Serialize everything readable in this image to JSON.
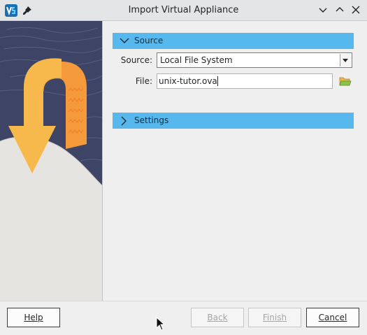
{
  "window": {
    "title": "Import Virtual Appliance"
  },
  "source_section": {
    "label": "Source",
    "source_label": "Source:",
    "source_value": "Local File System",
    "file_label": "File:",
    "file_value": "unix-tutor.ova"
  },
  "settings_section": {
    "label": "Settings"
  },
  "buttons": {
    "help": "Help",
    "back": "Back",
    "finish": "Finish",
    "cancel": "Cancel"
  },
  "colors": {
    "section_header": "#56b8ec",
    "side_dark": "#3d4466",
    "arrow_yellow": "#f7b94c",
    "arrow_orange": "#f59a3a"
  },
  "icons": {
    "app": "virtualbox-icon",
    "pin": "pin-icon",
    "minimize": "chevron-down-icon",
    "maximize": "chevron-up-icon",
    "close": "close-icon",
    "folder": "folder-open-icon",
    "combo": "dropdown-arrow-icon"
  }
}
